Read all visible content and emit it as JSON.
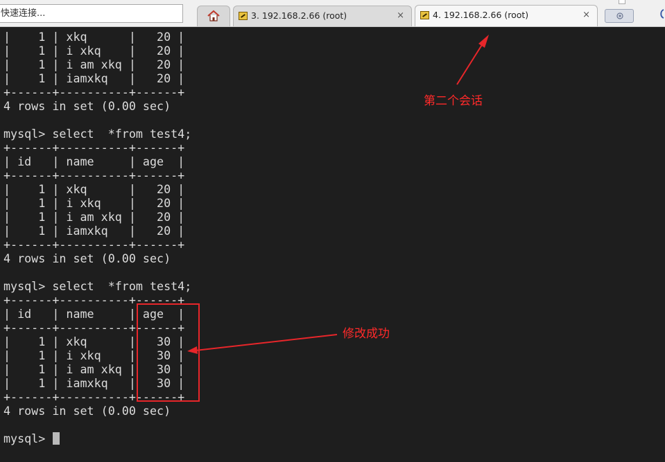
{
  "toolbar": {
    "quick_connect": "快速连接..."
  },
  "tabs": [
    {
      "label": "3. 192.168.2.66 (root)",
      "close": "×",
      "active": false
    },
    {
      "label": "4. 192.168.2.66 (root)",
      "close": "×",
      "active": true
    }
  ],
  "terminal": {
    "lines": [
      "|    1 | xkq      |   20 |",
      "|    1 | i xkq    |   20 |",
      "|    1 | i am xkq |   20 |",
      "|    1 | iamxkq   |   20 |",
      "+------+----------+------+",
      "4 rows in set (0.00 sec)",
      "",
      "mysql> select  *from test4;",
      "+------+----------+------+",
      "| id   | name     | age  |",
      "+------+----------+------+",
      "|    1 | xkq      |   20 |",
      "|    1 | i xkq    |   20 |",
      "|    1 | i am xkq |   20 |",
      "|    1 | iamxkq   |   20 |",
      "+------+----------+------+",
      "4 rows in set (0.00 sec)",
      "",
      "mysql> select  *from test4;",
      "+------+----------+------+",
      "| id   | name     | age  |",
      "+------+----------+------+",
      "|    1 | xkq      |   30 |",
      "|    1 | i xkq    |   30 |",
      "|    1 | i am xkq |   30 |",
      "|    1 | iamxkq   |   30 |",
      "+------+----------+------+",
      "4 rows in set (0.00 sec)",
      "",
      "mysql> "
    ]
  },
  "annotations": {
    "second_session": "第二个会话",
    "modified_success": "修改成功",
    "color": "#e8262a"
  }
}
